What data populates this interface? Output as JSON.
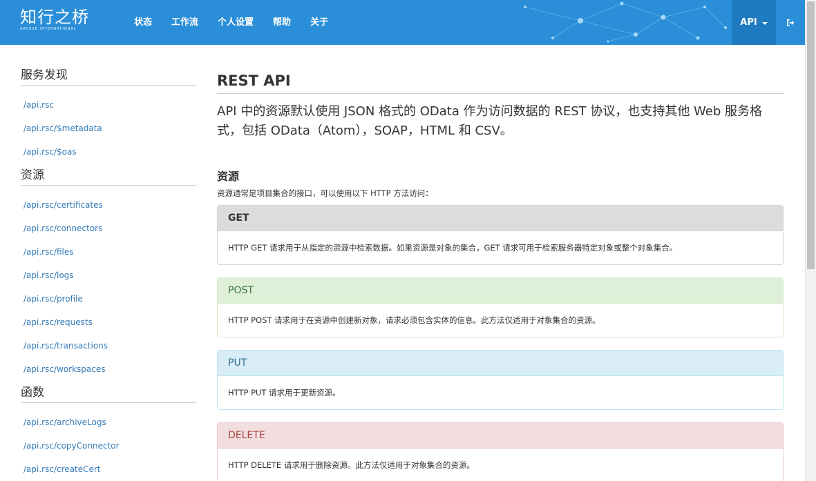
{
  "brand": {
    "name": "知行之桥",
    "subtitle": "ARCESB INTERNATIONAL"
  },
  "nav": {
    "items": [
      "状态",
      "工作流",
      "个人设置",
      "帮助",
      "关于"
    ],
    "api_menu": "API",
    "logout_icon": "sign-out-icon"
  },
  "sidebar": {
    "sections": [
      {
        "title": "服务发现",
        "links": [
          "/api.rsc",
          "/api.rsc/$metadata",
          "/api.rsc/$oas"
        ]
      },
      {
        "title": "资源",
        "links": [
          "/api.rsc/certificates",
          "/api.rsc/connectors",
          "/api.rsc/files",
          "/api.rsc/logs",
          "/api.rsc/profile",
          "/api.rsc/requests",
          "/api.rsc/transactions",
          "/api.rsc/workspaces"
        ]
      },
      {
        "title": "函数",
        "links": [
          "/api.rsc/archiveLogs",
          "/api.rsc/copyConnector",
          "/api.rsc/createCert"
        ]
      }
    ]
  },
  "main": {
    "title": "REST API",
    "lead": "API 中的资源默认使用 JSON 格式的 OData 作为访问数据的 REST 协议，也支持其他 Web 服务格式，包括 OData（Atom），SOAP，HTML 和 CSV。",
    "section_title": "资源",
    "section_desc": "资源通常是项目集合的接口，可以使用以下 HTTP 方法访问：",
    "methods": [
      {
        "name": "GET",
        "desc": "HTTP GET 请求用于从指定的资源中检索数据。如果资源是对象的集合，GET 请求可用于检索服务器特定对象或整个对象集合。",
        "color": "#dcdcdc"
      },
      {
        "name": "POST",
        "desc": "HTTP POST 请求用于在资源中创建新对象，请求必须包含实体的信息。此方法仅适用于对象集合的资源。",
        "color": "#dff0d8"
      },
      {
        "name": "PUT",
        "desc": "HTTP PUT 请求用于更新资源。",
        "color": "#d9edf7"
      },
      {
        "name": "DELETE",
        "desc": "HTTP DELETE 请求用于删除资源。此方法仅适用于对象集合的资源。",
        "color": "#f2dede"
      }
    ]
  },
  "colors": {
    "navbar": "#2a8fd8",
    "api_menu": "#1e7bc0",
    "link": "#337ab7"
  }
}
